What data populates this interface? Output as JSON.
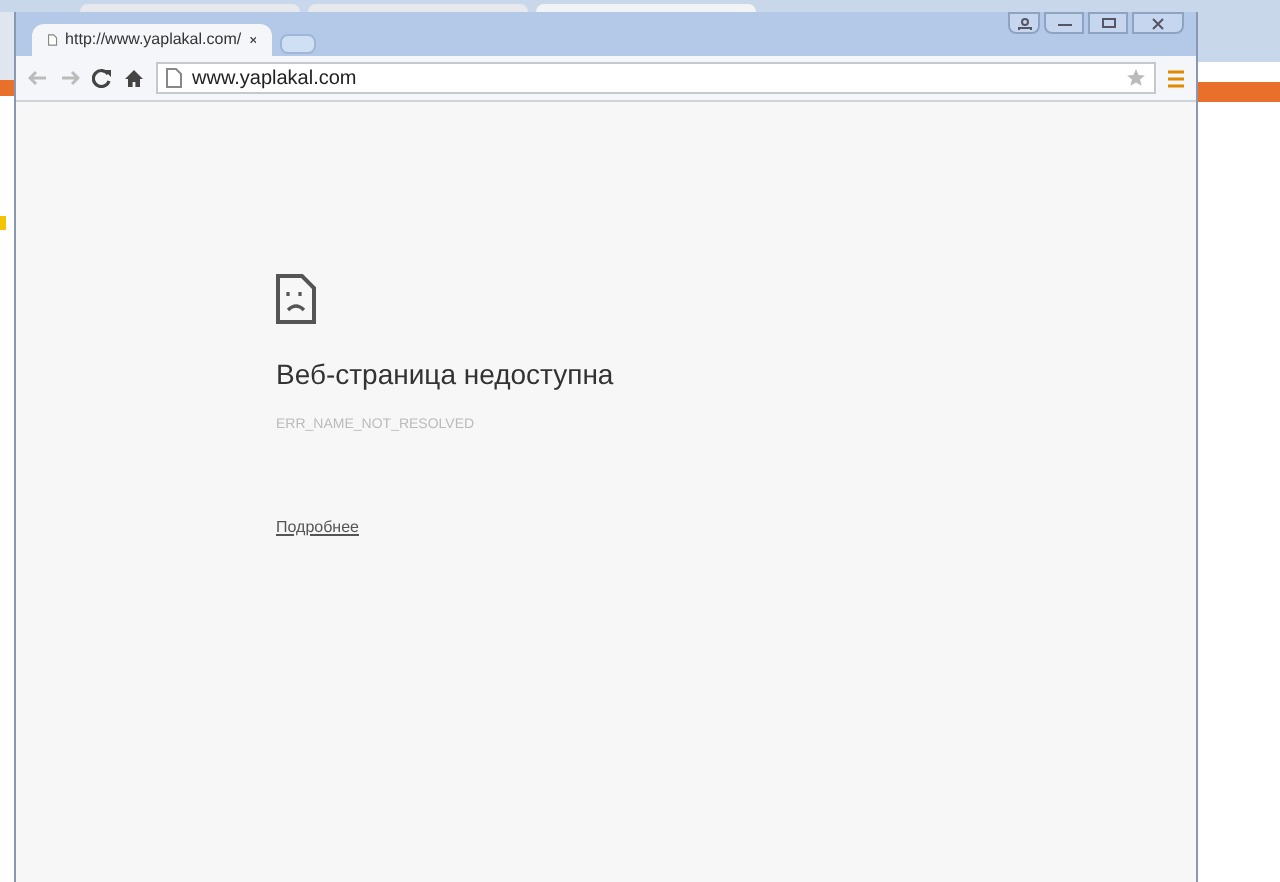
{
  "tabs": [
    {
      "title": "http://www.yaplakal.com/",
      "selected": true
    }
  ],
  "address_bar": {
    "value": "www.yaplakal.com"
  },
  "error_page": {
    "heading": "Веб-страница недоступна",
    "code": "ERR_NAME_NOT_RESOLVED",
    "details_link": "Подробнее"
  }
}
